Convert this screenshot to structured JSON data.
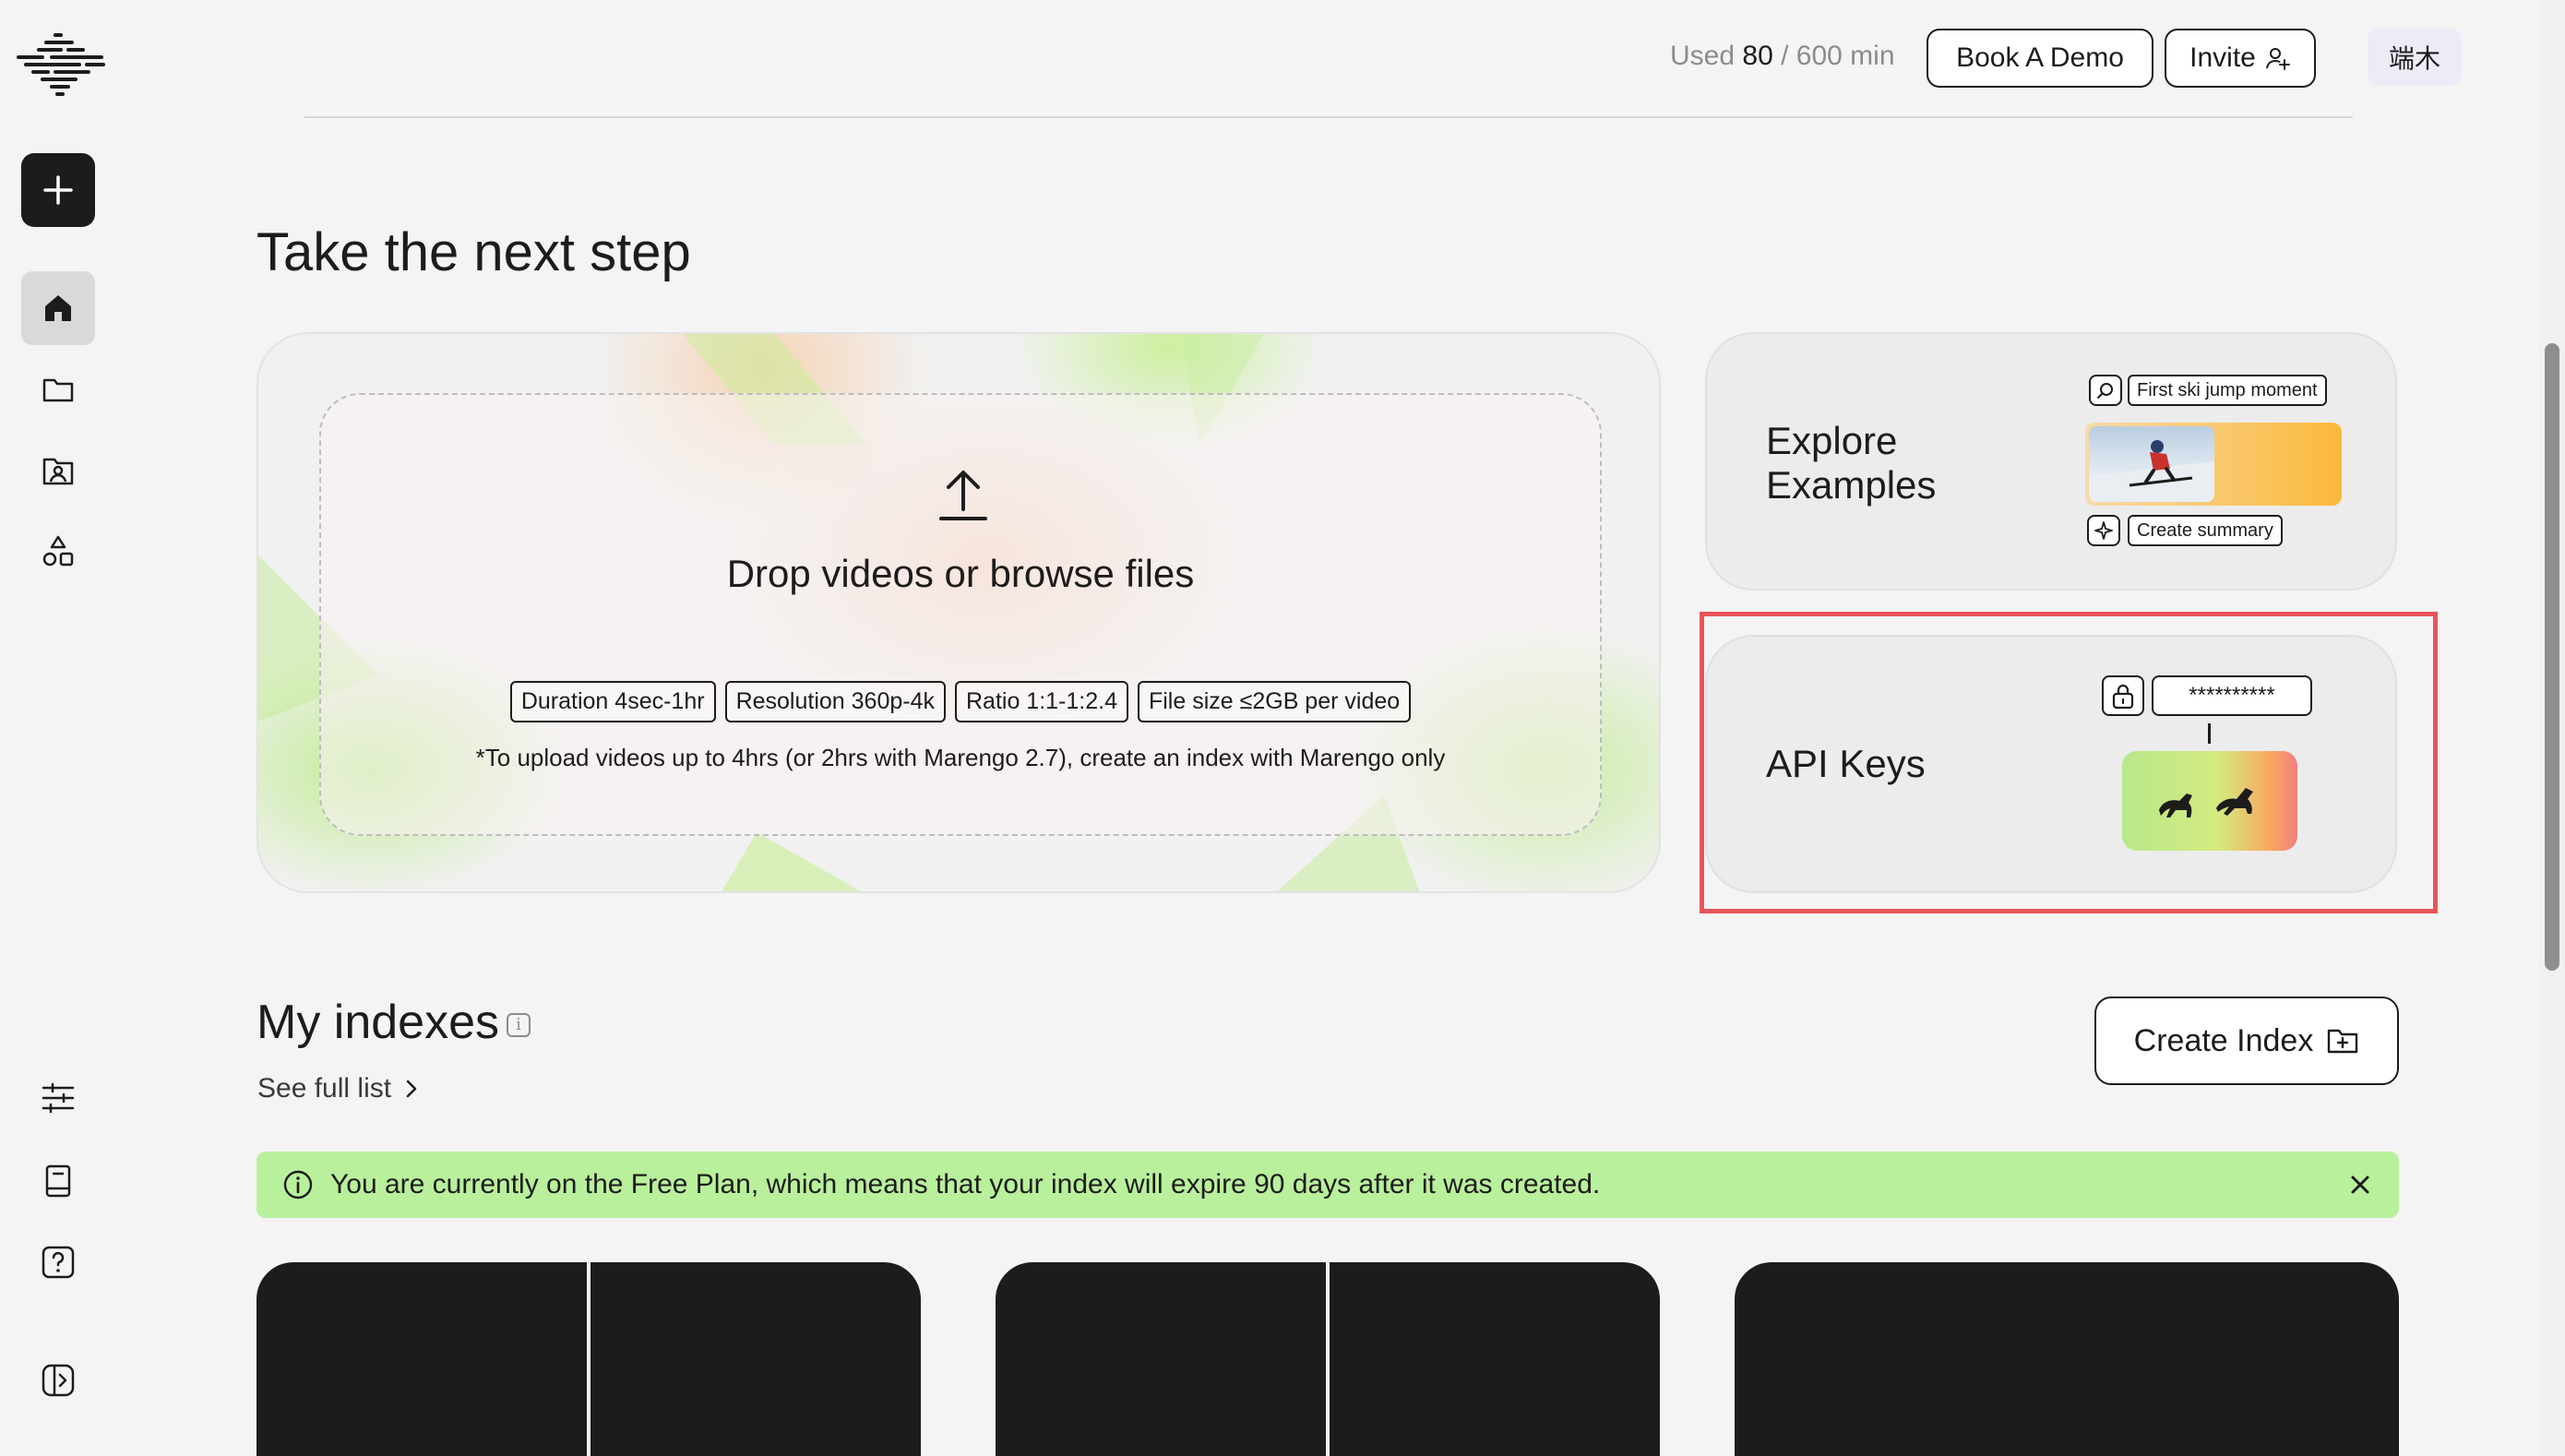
{
  "header": {
    "usage_prefix": "Used",
    "usage_used": "80",
    "usage_total": "/ 600 min",
    "book_demo_label": "Book A Demo",
    "invite_label": "Invite",
    "user_name": "端木"
  },
  "sidebar": {
    "items": [
      {
        "name": "home-icon"
      },
      {
        "name": "folder-icon"
      },
      {
        "name": "contact-folder-icon"
      },
      {
        "name": "shapes-icon"
      },
      {
        "name": "sliders-icon"
      },
      {
        "name": "book-icon"
      },
      {
        "name": "help-icon"
      },
      {
        "name": "collapse-sidebar-icon"
      }
    ]
  },
  "next_step": {
    "title": "Take the next step",
    "upload": {
      "prompt": "Drop videos or browse files",
      "tags": [
        "Duration 4sec-1hr",
        "Resolution 360p-4k",
        "Ratio 1:1-1:2.4",
        "File size ≤2GB per video"
      ],
      "note": "*To upload videos up to 4hrs (or 2hrs with Marengo 2.7), create an index with Marengo only"
    },
    "explore": {
      "title_line1": "Explore",
      "title_line2": "Examples",
      "search_chip": "First ski jump moment",
      "summary_chip": "Create summary"
    },
    "api_keys": {
      "title": "API Keys",
      "masked_key": "**********"
    }
  },
  "indexes": {
    "title": "My indexes",
    "see_full_list": "See full list",
    "create_index_label": "Create Index",
    "banner_text": "You are currently on the Free Plan, which means that your index will expire 90 days after it was created."
  },
  "colors": {
    "accent_dark": "#1d1c1b",
    "banner_green": "#b9f09c",
    "highlight_red": "#e8545a",
    "background": "#f4f4f4"
  }
}
